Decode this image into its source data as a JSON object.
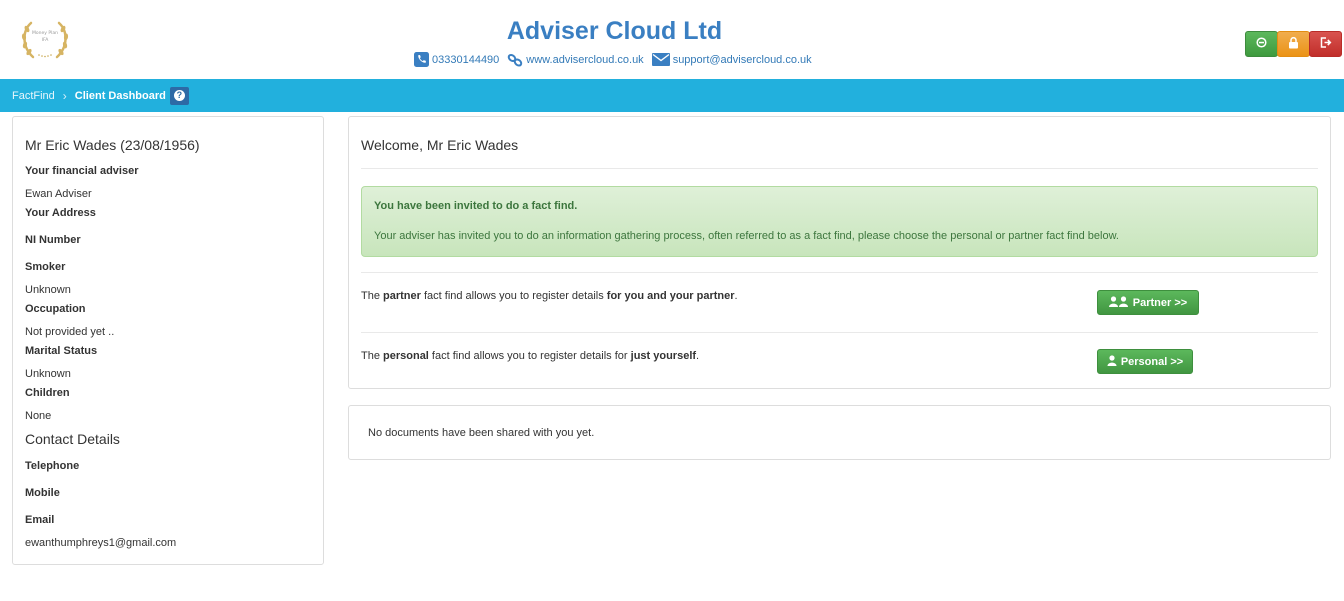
{
  "header": {
    "logo_text": "Money Plan IFA",
    "company": "Adviser Cloud Ltd",
    "phone": "03330144490",
    "website": "www.advisercloud.co.uk",
    "email": "support@advisercloud.co.uk"
  },
  "breadcrumb": {
    "item1": "FactFind",
    "separator": "›",
    "item2": "Client Dashboard",
    "help": "?"
  },
  "client": {
    "name": "Mr Eric Wades (23/08/1956)",
    "adviser_label": "Your financial adviser",
    "adviser_value": "Ewan Adviser",
    "address_label": "Your Address",
    "ni_label": "NI Number",
    "smoker_label": "Smoker",
    "smoker_value": "Unknown",
    "occupation_label": "Occupation",
    "occupation_value": "Not provided yet ..",
    "marital_label": "Marital Status",
    "marital_value": "Unknown",
    "children_label": "Children",
    "children_value": "None",
    "contact_heading": "Contact Details",
    "telephone_label": "Telephone",
    "mobile_label": "Mobile",
    "email_label": "Email",
    "email_value": "ewanthumphreys1@gmail.com"
  },
  "welcome": {
    "title": "Welcome, Mr Eric Wades",
    "alert_title": "You have been invited to do a fact find.",
    "alert_body": "Your adviser has invited you to do an information gathering process, often referred to as a fact find, please choose the personal or partner fact find below.",
    "partner": {
      "t1": "The ",
      "b1": "partner",
      "t2": " fact find allows you to register details ",
      "b2": "for you and your partner",
      "t3": ".",
      "button": "Partner >>"
    },
    "personal": {
      "t1": "The ",
      "b1": "personal",
      "t2": " fact find allows you to register details for ",
      "b2": "just yourself",
      "t3": ".",
      "button": "Personal >>"
    }
  },
  "documents": {
    "message": "No documents have been shared with you yet."
  },
  "colors": {
    "brand_blue": "#3a7fc2",
    "bar_blue": "#22b0dd",
    "success_green": "#5cb85c",
    "warning_orange": "#f0ad4e",
    "danger_red": "#d9534f"
  }
}
